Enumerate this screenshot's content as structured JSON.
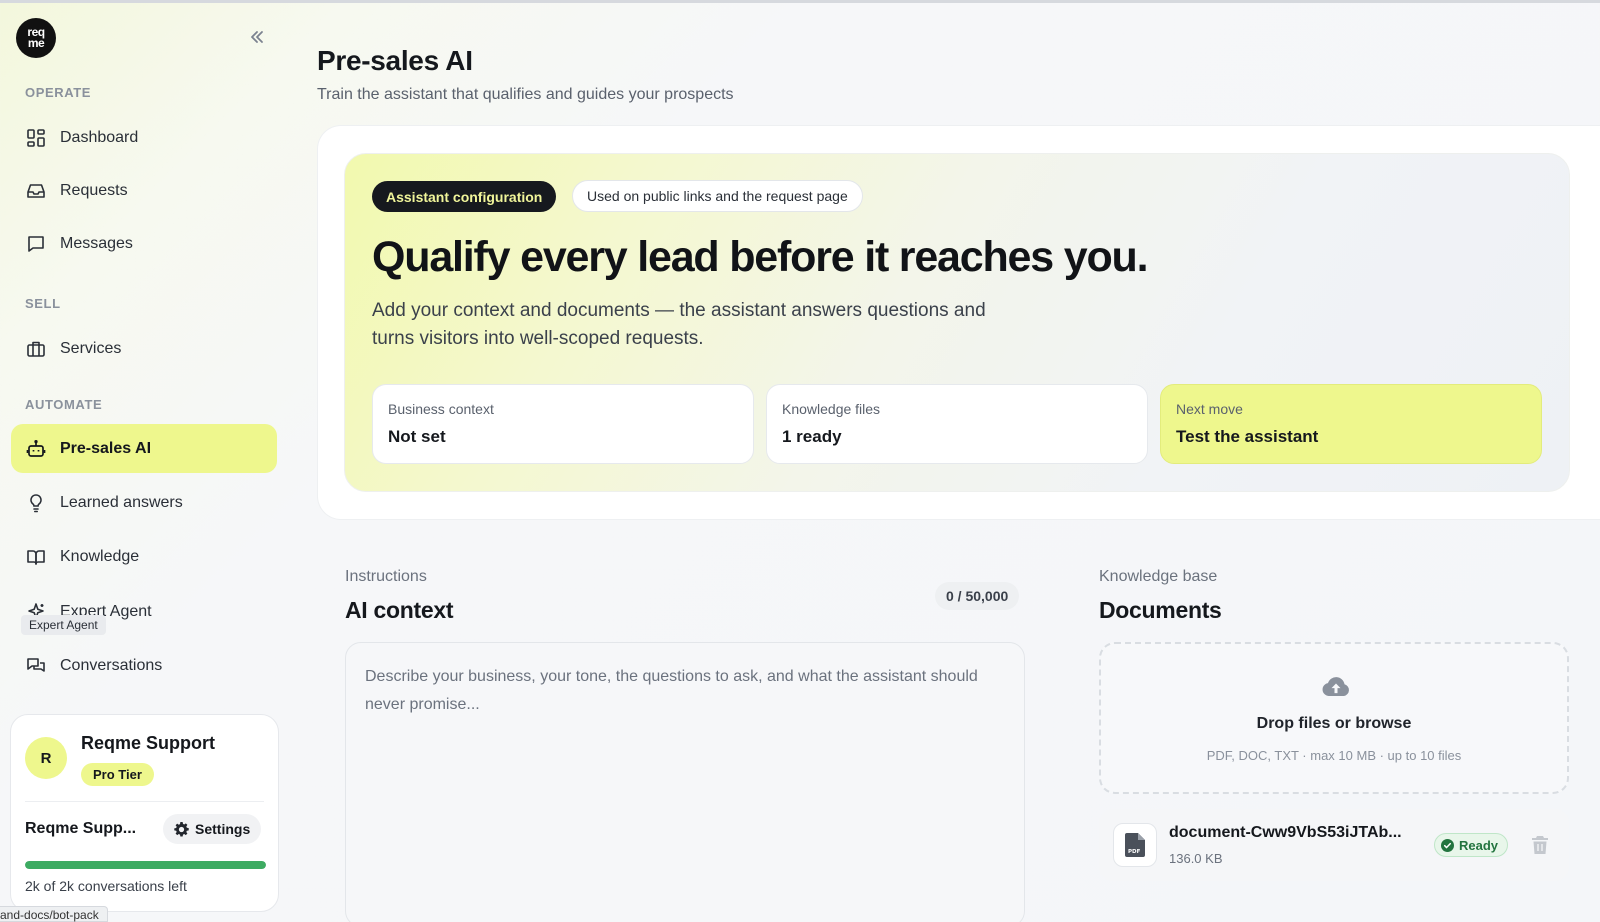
{
  "logo": {
    "text_line1": "req",
    "text_line2": "me"
  },
  "sidebar": {
    "sections": {
      "operate": "OPERATE",
      "sell": "SELL",
      "automate": "AUTOMATE"
    },
    "items": [
      {
        "label": "Dashboard",
        "icon": "grid-icon"
      },
      {
        "label": "Requests",
        "icon": "inbox-icon"
      },
      {
        "label": "Messages",
        "icon": "message-icon"
      },
      {
        "label": "Services",
        "icon": "briefcase-icon"
      },
      {
        "label": "Pre-sales AI",
        "icon": "bot-icon",
        "active": true
      },
      {
        "label": "Learned answers",
        "icon": "lightbulb-icon"
      },
      {
        "label": "Knowledge",
        "icon": "book-icon"
      },
      {
        "label": "Expert Agent",
        "icon": "sparkle-icon"
      },
      {
        "label": "Conversations",
        "icon": "chat-icon"
      }
    ],
    "tooltip": "Expert Agent"
  },
  "account": {
    "avatar_initial": "R",
    "name": "Reqme Support",
    "tier": "Pro Tier",
    "short_name": "Reqme Supp...",
    "settings_label": "Settings",
    "usage_fraction": 1.0,
    "usage_text": "2k of 2k conversations left",
    "progress_color": "#3dab62"
  },
  "url_hint": "and-docs/bot-pack",
  "page": {
    "title": "Pre-sales AI",
    "subtitle": "Train the assistant that qualifies and guides your prospects"
  },
  "hero": {
    "chip_primary": "Assistant configuration",
    "chip_secondary": "Used on public links and the request page",
    "title": "Qualify every lead before it reaches you.",
    "description": "Add your context and documents — the assistant answers questions and turns visitors into well-scoped requests.",
    "stats": [
      {
        "label": "Business context",
        "value": "Not set"
      },
      {
        "label": "Knowledge files",
        "value": "1 ready"
      },
      {
        "label": "Next move",
        "value": "Test the assistant"
      }
    ]
  },
  "instructions": {
    "kicker": "Instructions",
    "title": "AI context",
    "counter": "0 / 50,000",
    "placeholder": "Describe your business, your tone, the questions to ask, and what the assistant should never promise..."
  },
  "knowledge_base": {
    "kicker": "Knowledge base",
    "title": "Documents",
    "drop_title": "Drop files or browse",
    "drop_hint": "PDF, DOC, TXT · max 10 MB · up to 10 files",
    "documents": [
      {
        "name": "document-Cww9VbS53iJTAb...",
        "size": "136.0 KB",
        "status": "Ready",
        "type_label": "PDF"
      }
    ]
  },
  "colors": {
    "accent": "#eef78d",
    "dark_chip": "#16191e",
    "success": "#23743f"
  }
}
